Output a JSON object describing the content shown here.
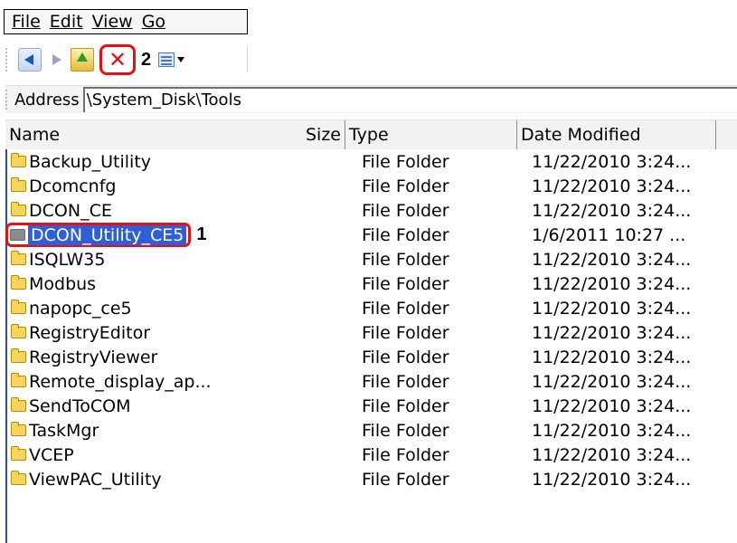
{
  "menu": [
    "File",
    "Edit",
    "View",
    "Go"
  ],
  "toolbar": {
    "back_icon": "back-arrow-icon",
    "forward_icon": "forward-arrow-icon",
    "up_icon": "up-folder-icon",
    "delete_icon": "delete-icon",
    "annotation_2": "2",
    "views_icon": "views-icon"
  },
  "address": {
    "label": "Address",
    "path": "\\System_Disk\\Tools"
  },
  "columns": {
    "name": "Name",
    "size": "Size",
    "type": "Type",
    "date": "Date Modified"
  },
  "annotation_1": "1",
  "rows": [
    {
      "name": "Backup_Utility",
      "type": "File Folder",
      "date": "11/22/2010 3:24..."
    },
    {
      "name": "Dcomcnfg",
      "type": "File Folder",
      "date": "11/22/2010 3:24..."
    },
    {
      "name": "DCON_CE",
      "type": "File Folder",
      "date": "11/22/2010 3:24..."
    },
    {
      "name": "DCON_Utility_CE5",
      "type": "File Folder",
      "date": "1/6/2011 10:27 ...",
      "selected": true
    },
    {
      "name": "ISQLW35",
      "type": "File Folder",
      "date": "11/22/2010 3:24..."
    },
    {
      "name": "Modbus",
      "type": "File Folder",
      "date": "11/22/2010 3:24..."
    },
    {
      "name": "napopc_ce5",
      "type": "File Folder",
      "date": "11/22/2010 3:24..."
    },
    {
      "name": "RegistryEditor",
      "type": "File Folder",
      "date": "11/22/2010 3:24..."
    },
    {
      "name": "RegistryViewer",
      "type": "File Folder",
      "date": "11/22/2010 3:24..."
    },
    {
      "name": "Remote_display_ap...",
      "type": "File Folder",
      "date": "11/22/2010 3:24..."
    },
    {
      "name": "SendToCOM",
      "type": "File Folder",
      "date": "11/22/2010 3:24..."
    },
    {
      "name": "TaskMgr",
      "type": "File Folder",
      "date": "11/22/2010 3:24..."
    },
    {
      "name": "VCEP",
      "type": "File Folder",
      "date": "11/22/2010 3:24..."
    },
    {
      "name": "ViewPAC_Utility",
      "type": "File Folder",
      "date": "11/22/2010 3:24..."
    }
  ],
  "colors": {
    "selection": "#2f5fd6",
    "highlight_border": "#e80f0f",
    "folder": "#f6d55c"
  }
}
